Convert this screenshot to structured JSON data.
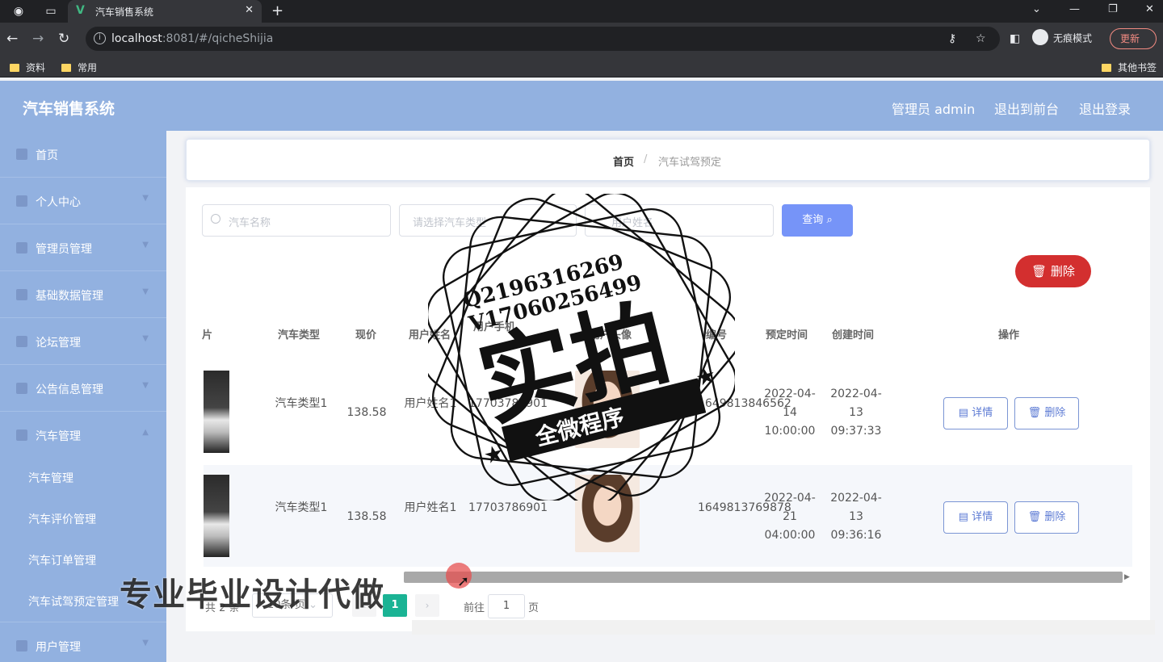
{
  "browser": {
    "tab_title": "汽车销售系统",
    "url_host": "localhost",
    "url_rest": ":8081/#/qicheShijia",
    "incognito_label": "无痕模式",
    "update_label": "更新",
    "bookmarks": [
      "资料",
      "常用"
    ],
    "other_bookmarks": "其他书签"
  },
  "header": {
    "title": "汽车销售系统",
    "admin": "管理员 admin",
    "to_front": "退出到前台",
    "logout": "退出登录"
  },
  "sidebar": {
    "items": [
      {
        "label": "首页"
      },
      {
        "label": "个人中心"
      },
      {
        "label": "管理员管理"
      },
      {
        "label": "基础数据管理"
      },
      {
        "label": "论坛管理"
      },
      {
        "label": "公告信息管理"
      },
      {
        "label": "汽车管理"
      }
    ],
    "sub_items": [
      "汽车管理",
      "汽车评价管理",
      "汽车订单管理",
      "汽车试驾预定管理"
    ],
    "last_item": "用户管理"
  },
  "breadcrumb": {
    "home": "首页",
    "separator": "/",
    "current": "汽车试驾预定"
  },
  "search": {
    "car_name_placeholder": "汽车名称",
    "car_type_placeholder": "请选择汽车类型",
    "user_name_placeholder": "用户姓名",
    "query_label": "查询"
  },
  "toolbar": {
    "delete_label": "删除"
  },
  "table": {
    "headers": [
      "片",
      "汽车类型",
      "现价",
      "用户姓名",
      "用户手机",
      "用户头像",
      "编号",
      "预定时间",
      "创建时间",
      "操作"
    ],
    "rows": [
      {
        "type": "汽车类型1",
        "price": "138.58",
        "user_name": "用户姓名1",
        "phone": "17703786901",
        "number": "1649813846562",
        "reserve_time": "2022-04-14 10:00:00",
        "create_time": "2022-04-13 09:37:33"
      },
      {
        "type": "汽车类型1",
        "price": "138.58",
        "user_name": "用户姓名1",
        "phone": "17703786901",
        "number": "1649813769878",
        "reserve_time": "2022-04-21 04:00:00",
        "create_time": "2022-04-13 09:36:16"
      }
    ],
    "detail_label": "详情",
    "delete_label": "删除"
  },
  "pagination": {
    "total": "共 2 条",
    "page_size": "10条/页",
    "current_page": "1",
    "goto_label": "前往",
    "goto_value": "1",
    "page_unit": "页"
  },
  "watermark": {
    "line1": "Q2196316269",
    "line2": "V17060256499",
    "big": "实拍",
    "ribbon": "全微程序",
    "banner": "专业毕业设计代做"
  }
}
